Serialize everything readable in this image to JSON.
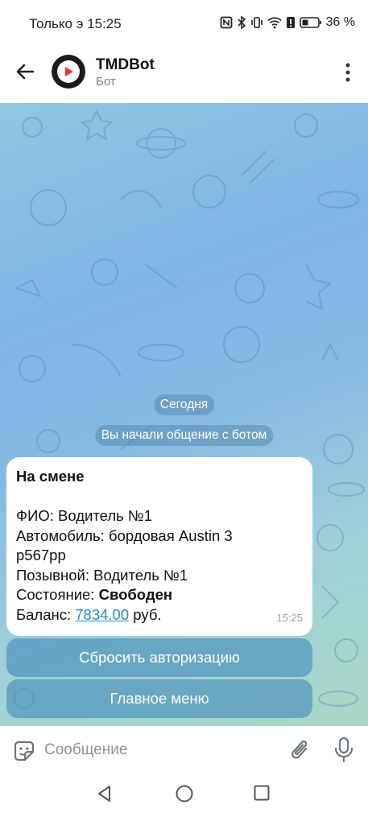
{
  "status_bar": {
    "time": "Только э 15:25",
    "battery": "36 %"
  },
  "header": {
    "title": "TMDBot",
    "subtitle": "Бот",
    "icons": [
      "back-arrow-icon",
      "bot-avatar-play-icon",
      "more-vert-icon"
    ]
  },
  "chat": {
    "date_label": "Сегодня",
    "service_message": "Вы начали общение с ботом",
    "message": {
      "heading": "На смене",
      "fio_label": "ФИО: ",
      "fio_value": "Водитель №1",
      "car_label": "Автомобиль: ",
      "car_value": "бордовая Austin 3",
      "plate": "р567рр",
      "callsign_label": "Позывной: ",
      "callsign_value": "Водитель №1",
      "state_label": "Состояние: ",
      "state_value": "Свободен",
      "balance_label": "Баланс: ",
      "balance_value": "7834.00",
      "balance_unit": " руб.",
      "time": "15:25"
    },
    "buttons": {
      "reset_auth": "Сбросить авторизацию",
      "main_menu": "Главное меню"
    }
  },
  "input": {
    "placeholder": "Сообщение"
  },
  "colors": {
    "accent": "#2a8bc9",
    "inline_button": "#448cb9",
    "bubble": "#ffffff"
  }
}
